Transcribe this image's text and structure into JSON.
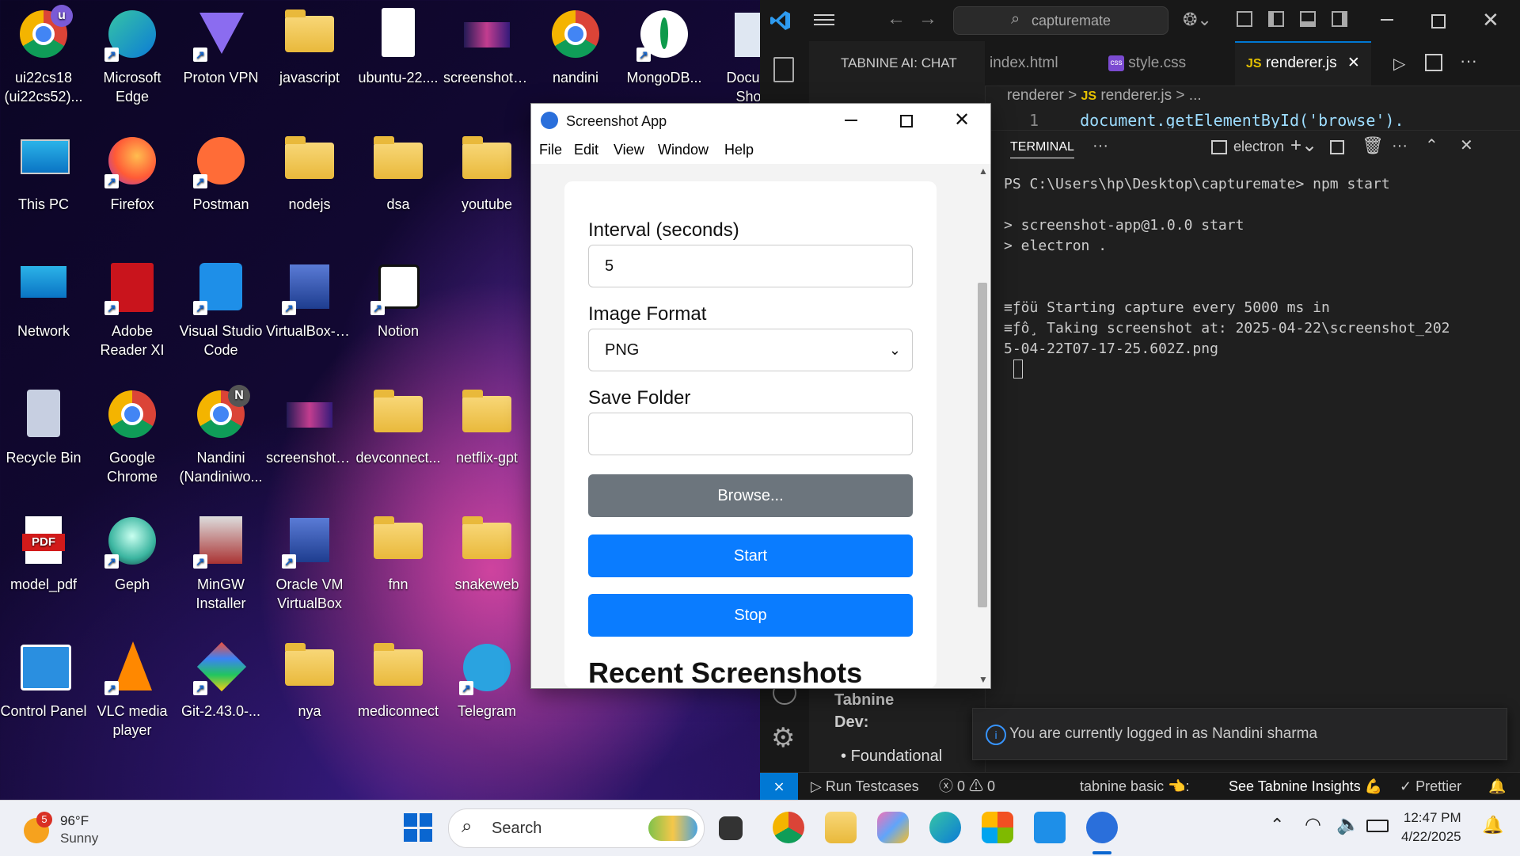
{
  "desktop": {
    "icons": [
      {
        "l1": "ui22cs18",
        "l2": "(ui22cs52)..."
      },
      {
        "l1": "Microsoft",
        "l2": "Edge"
      },
      {
        "l1": "Proton VPN",
        "l2": ""
      },
      {
        "l1": "javascript",
        "l2": ""
      },
      {
        "l1": "ubuntu-22....",
        "l2": ""
      },
      {
        "l1": "screenshot_...",
        "l2": ""
      },
      {
        "l1": "nandini",
        "l2": ""
      },
      {
        "l1": "MongoDB...",
        "l2": ""
      },
      {
        "l1": "Docume",
        "l2": "Short"
      },
      {
        "l1": "This PC",
        "l2": ""
      },
      {
        "l1": "Firefox",
        "l2": ""
      },
      {
        "l1": "Postman",
        "l2": ""
      },
      {
        "l1": "nodejs",
        "l2": ""
      },
      {
        "l1": "dsa",
        "l2": ""
      },
      {
        "l1": "youtube",
        "l2": ""
      },
      {
        "l1": "Network",
        "l2": ""
      },
      {
        "l1": "Adobe",
        "l2": "Reader XI"
      },
      {
        "l1": "Visual Studio",
        "l2": "Code"
      },
      {
        "l1": "VirtualBox-7....",
        "l2": ""
      },
      {
        "l1": "Notion",
        "l2": ""
      },
      {
        "l1": "Recycle Bin",
        "l2": ""
      },
      {
        "l1": "Google",
        "l2": "Chrome"
      },
      {
        "l1": "Nandini",
        "l2": "(Nandiniwo..."
      },
      {
        "l1": "screenshot_...",
        "l2": ""
      },
      {
        "l1": "devconnect...",
        "l2": ""
      },
      {
        "l1": "netflix-gpt",
        "l2": ""
      },
      {
        "l1": "model_pdf",
        "l2": ""
      },
      {
        "l1": "Geph",
        "l2": ""
      },
      {
        "l1": "MinGW",
        "l2": "Installer"
      },
      {
        "l1": "Oracle VM",
        "l2": "VirtualBox"
      },
      {
        "l1": "fnn",
        "l2": ""
      },
      {
        "l1": "snakeweb",
        "l2": ""
      },
      {
        "l1": "Control Panel",
        "l2": ""
      },
      {
        "l1": "VLC media",
        "l2": "player"
      },
      {
        "l1": "Git-2.43.0-...",
        "l2": ""
      },
      {
        "l1": "nya",
        "l2": ""
      },
      {
        "l1": "mediconnect",
        "l2": ""
      },
      {
        "l1": "Telegram",
        "l2": ""
      }
    ],
    "badge_u": "u",
    "badge_n": "N",
    "pdf_text": "PDF"
  },
  "vscode": {
    "search_text": "capturemate",
    "panel_title": "TABNINE AI: CHAT",
    "tabs": {
      "index": "index.html",
      "style": "style.css",
      "renderer": "renderer.js",
      "css_badge": "css",
      "js_badge": "JS"
    },
    "breadcrumb": {
      "folder": "renderer",
      "sep": ">",
      "js": "JS",
      "file": "renderer.js",
      "more": "> ..."
    },
    "code_line_no": "1",
    "code_text": "document.getElementById('browse').",
    "terminal_tab": "TERMINAL",
    "terminal_more": "···",
    "shell_name": "electron",
    "terminal_lines": [
      "PS C:\\Users\\hp\\Desktop\\capturemate> npm start",
      "",
      "> screenshot-app@1.0.0 start",
      "> electron .",
      "",
      "",
      "≡ƒöü Starting capture every 5000 ms in",
      "≡ƒô¸ Taking screenshot at: 2025-04-22\\screenshot_202",
      "5-04-22T07-17-25.602Z.png"
    ],
    "chat_heading_1": "Tabnine",
    "chat_heading_2": "Dev:",
    "chat_bullet": "Foundational",
    "notification": "You are currently logged in as Nandini sharma",
    "status": {
      "run": "Run Testcases",
      "errors": "0",
      "warnings": "0",
      "tabnine": "tabnine basic 👈:",
      "insights": "See Tabnine Insights 💪",
      "prettier": "✓ Prettier"
    }
  },
  "app": {
    "title": "Screenshot App",
    "menu": [
      "File",
      "Edit",
      "View",
      "Window",
      "Help"
    ],
    "interval_label": "Interval (seconds)",
    "interval_value": "5",
    "format_label": "Image Format",
    "format_value": "PNG",
    "folder_label": "Save Folder",
    "folder_value": "",
    "browse_label": "Browse...",
    "start_label": "Start",
    "stop_label": "Stop",
    "recent_heading": "Recent Screenshots",
    "colors": {
      "primary": "#0a7cff",
      "secondary": "#6c757d"
    }
  },
  "taskbar": {
    "weather_temp": "96°F",
    "weather_desc": "Sunny",
    "weather_badge": "5",
    "search_placeholder": "Search",
    "time": "12:47 PM",
    "date": "4/22/2025"
  }
}
